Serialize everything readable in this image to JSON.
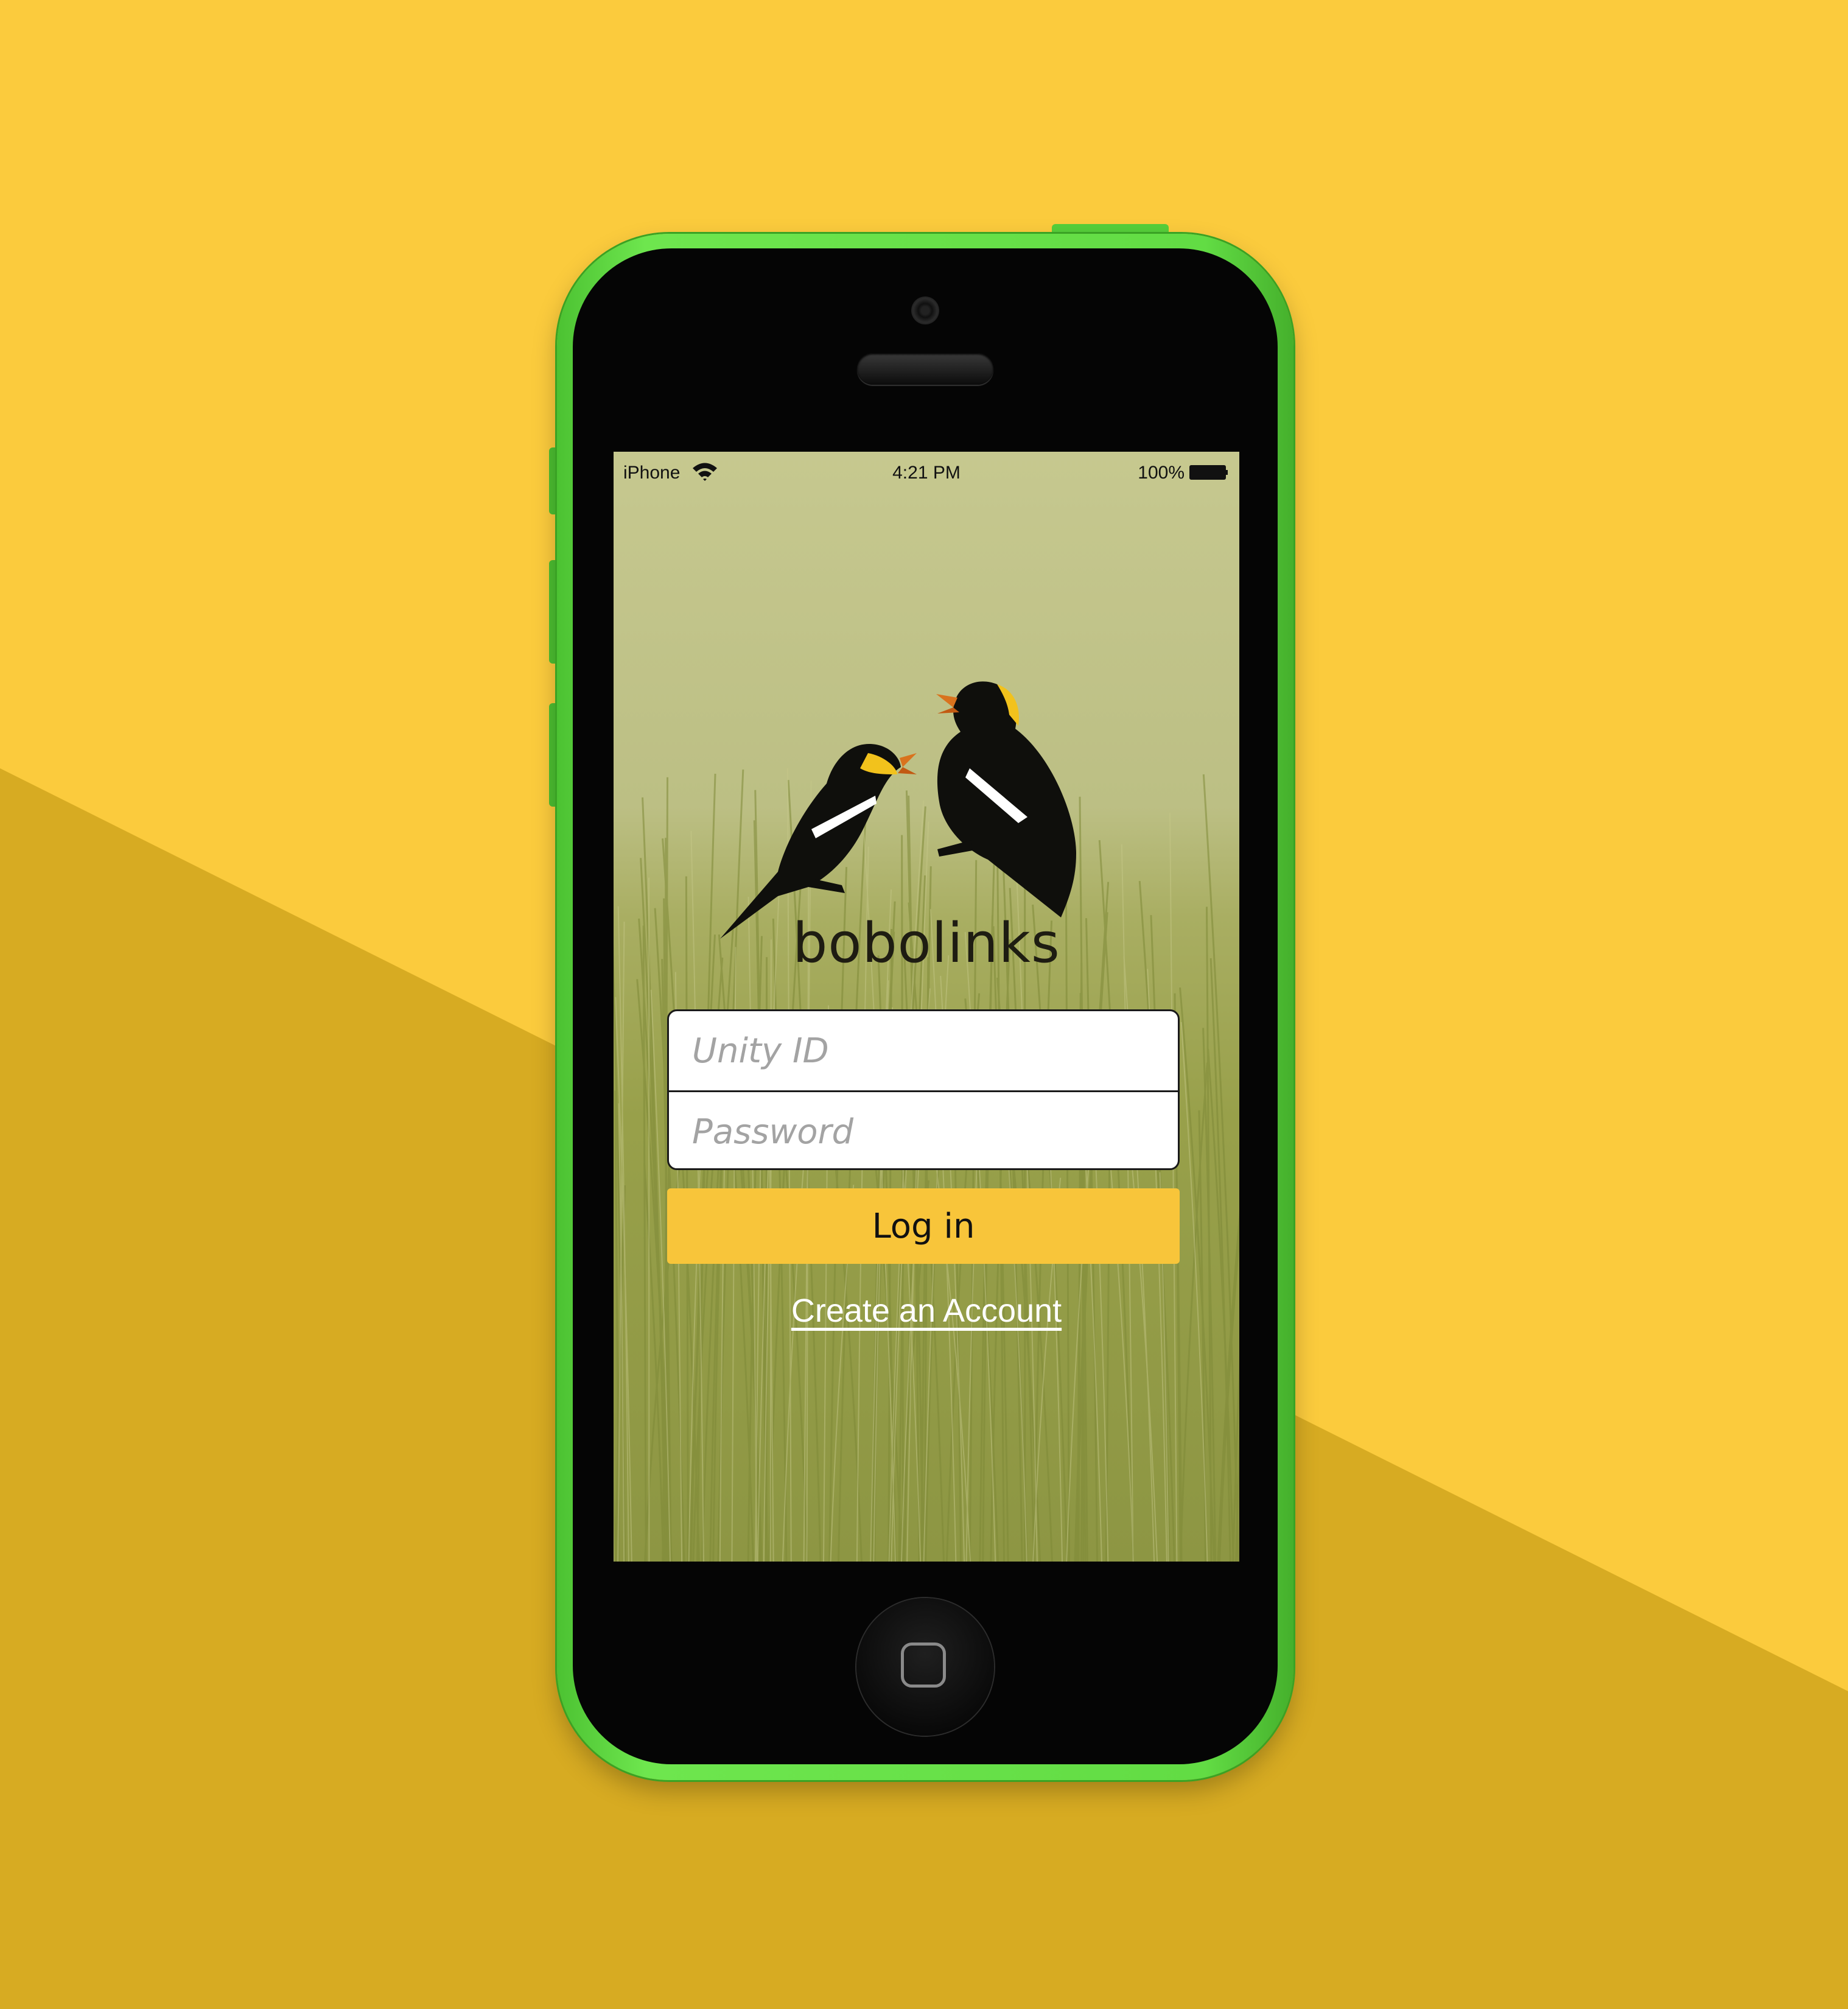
{
  "colors": {
    "background_light": "#fbcb3d",
    "background_dark": "#d7ab22",
    "phone_body": "#5fd93f",
    "accent": "#f8c53a"
  },
  "status_bar": {
    "carrier": "iPhone",
    "time": "4:21 PM",
    "battery": "100%",
    "icons": [
      "wifi-icon",
      "battery-icon"
    ]
  },
  "app": {
    "logo_icon": "bobolink-birds-icon",
    "name": "bobolinks"
  },
  "login_form": {
    "unity_id": {
      "placeholder": "Unity ID",
      "value": ""
    },
    "password": {
      "placeholder": "Password",
      "value": ""
    },
    "submit_label": "Log in",
    "create_account_label": "Create an Account"
  }
}
